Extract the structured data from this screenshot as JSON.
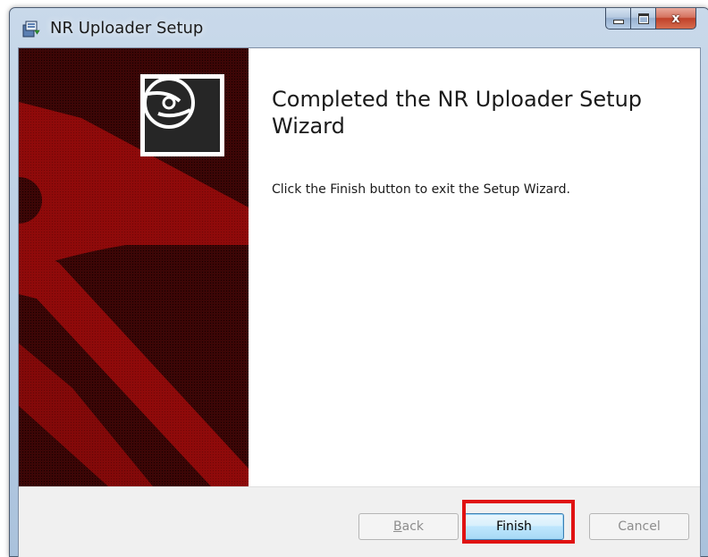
{
  "window": {
    "title": "NR Uploader Setup",
    "icons": {
      "app": "installer-icon",
      "minimize": "minimize-icon",
      "maximize": "maximize-icon",
      "close": "close-icon",
      "banner": "cd-disc-icon"
    },
    "close_glyph": "x"
  },
  "wizard": {
    "heading": "Completed the NR Uploader Setup Wizard",
    "message": "Click the Finish button to exit the Setup Wizard."
  },
  "buttons": {
    "back_prefix": "",
    "back_mnemonic": "B",
    "back_rest": "ack",
    "finish": "Finish",
    "cancel": "Cancel"
  },
  "colors": {
    "banner_background": "#3c0606",
    "banner_accent": "#8f0a0a",
    "highlight": "#e01212",
    "default_button_border": "#3c7fb1"
  }
}
